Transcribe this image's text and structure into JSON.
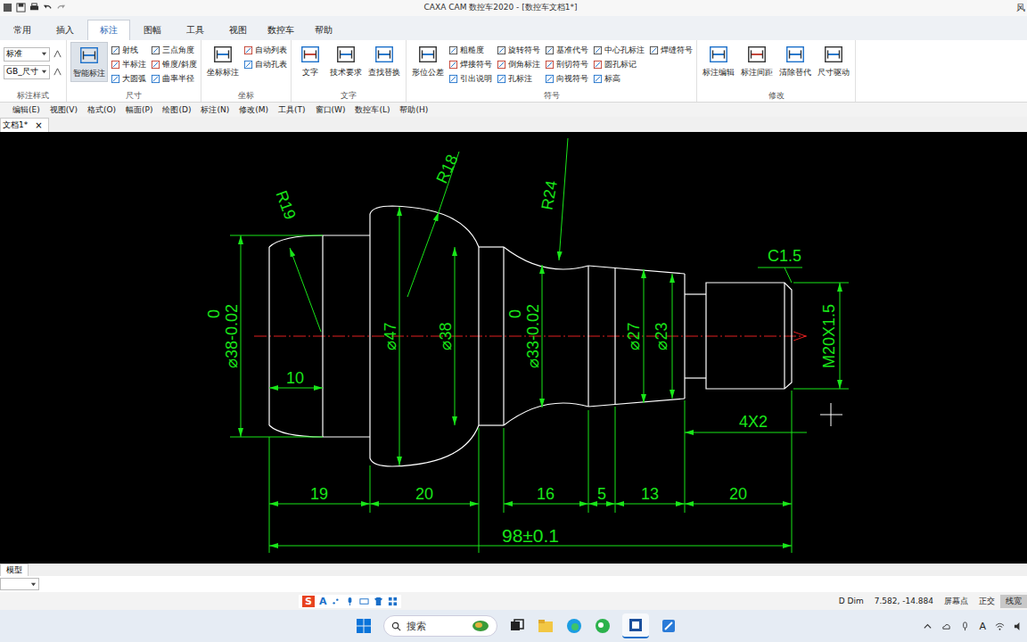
{
  "window": {
    "title": "CAXA CAM 数控车2020 - [数控车文档1*]",
    "corner": "风"
  },
  "ribbon_tabs": [
    {
      "label": "常用",
      "selected": false
    },
    {
      "label": "插入",
      "selected": false
    },
    {
      "label": "标注",
      "selected": true
    },
    {
      "label": "图幅",
      "selected": false
    },
    {
      "label": "工具",
      "selected": false
    },
    {
      "label": "视图",
      "selected": false
    },
    {
      "label": "数控车",
      "selected": false
    },
    {
      "label": "帮助",
      "selected": false
    }
  ],
  "ribbon_groups": [
    {
      "label": "标注样式",
      "fields": [
        "标准",
        "GB_尺寸"
      ],
      "large": [],
      "small": []
    },
    {
      "label": "尺寸",
      "fields": [],
      "large": [
        {
          "label": "智能标注",
          "selected": true
        }
      ],
      "small": [
        "射线",
        "半标注",
        "大圆弧",
        "三点角度",
        "锥度/斜度",
        "曲率半径"
      ]
    },
    {
      "label": "坐标",
      "fields": [],
      "large": [
        {
          "label": "坐标标注",
          "selected": false
        }
      ],
      "small": [
        "自动列表",
        "自动孔表"
      ]
    },
    {
      "label": "文字",
      "fields": [],
      "large": [
        {
          "label": "文字",
          "selected": false
        },
        {
          "label": "技术要求",
          "selected": false
        },
        {
          "label": "查找替换",
          "selected": false
        }
      ],
      "small": []
    },
    {
      "label": "符号",
      "fields": [],
      "large": [
        {
          "label": "形位公差",
          "selected": false
        }
      ],
      "small": [
        "粗糙度",
        "焊接符号",
        "引出说明",
        "旋转符号",
        "倒角标注",
        "孔标注",
        "基准代号",
        "剖切符号",
        "向视符号",
        "中心孔标注",
        "圆孔标记",
        "标高",
        "焊缝符号"
      ]
    },
    {
      "label": "修改",
      "fields": [],
      "large": [
        {
          "label": "标注编辑",
          "selected": false
        },
        {
          "label": "标注间距",
          "selected": false
        },
        {
          "label": "清除替代",
          "selected": false
        },
        {
          "label": "尺寸驱动",
          "selected": false
        }
      ],
      "small": []
    }
  ],
  "menu": [
    "编辑(E)",
    "视图(V)",
    "格式(O)",
    "幅面(P)",
    "绘图(D)",
    "标注(N)",
    "修改(M)",
    "工具(T)",
    "窗口(W)",
    "数控车(L)",
    "帮助(H)"
  ],
  "doc_tab": {
    "label": "文档1*",
    "close": "×"
  },
  "drawing": {
    "dims": [
      "R19",
      "R18",
      "R24",
      "C1.5",
      "⌀38-0.02",
      "0",
      "10",
      "⌀47",
      "⌀38",
      "⌀33-0.02",
      "0",
      "⌀27",
      "⌀23",
      "M20X1.5",
      "4X2",
      "19",
      "20",
      "16",
      "5",
      "13",
      "20",
      "98±0.1"
    ]
  },
  "model_tab": "模型",
  "ime_bar": {
    "logo": "S",
    "mode": "A"
  },
  "status_bar": [
    {
      "label": "D Dim",
      "selected": false
    },
    {
      "label": "7.582, -14.884",
      "selected": false
    },
    {
      "label": "屏幕点",
      "selected": false
    },
    {
      "label": "正交",
      "selected": false
    },
    {
      "label": "线宽",
      "selected": true
    }
  ],
  "taskbar": {
    "search": "搜索",
    "tray_ime": "A"
  }
}
